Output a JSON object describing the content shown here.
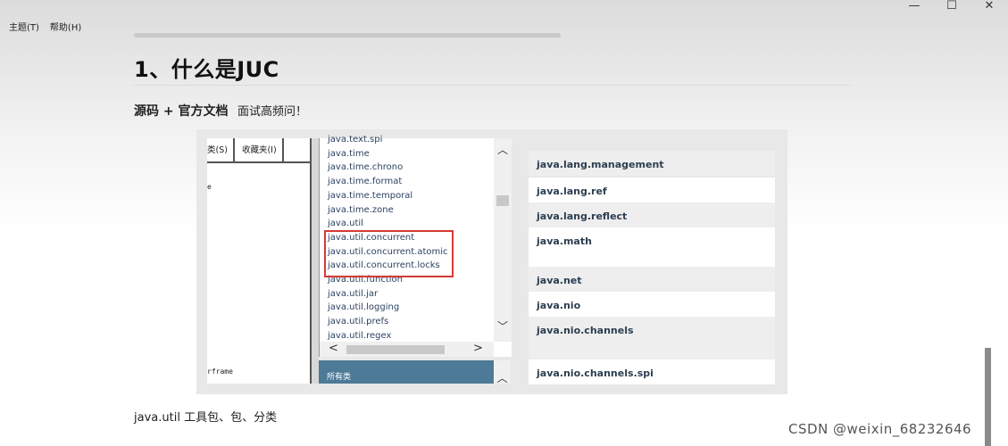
{
  "window": {
    "minimize": "—",
    "maximize": "☐",
    "close": "✕"
  },
  "menu": [
    "主题(T)",
    "帮助(H)"
  ],
  "article": {
    "heading": "1、什么是JUC",
    "subline_bold": "源码 + 官方文档",
    "subline_normal": "面试高频问！",
    "bottom_text": "java.util 工具包、包、分类"
  },
  "screenshot": {
    "tabs": [
      "类(S)",
      "收藏夹(I)"
    ],
    "left_fragment_top": "e",
    "left_fragment_bottom": "rframe",
    "packages": [
      "java.text.spi",
      "java.time",
      "java.time.chrono",
      "java.time.format",
      "java.time.temporal",
      "java.time.zone",
      "java.util",
      "java.util.concurrent",
      "java.util.concurrent.atomic",
      "java.util.concurrent.locks",
      "java.util.function",
      "java.util.jar",
      "java.util.logging",
      "java.util.prefs",
      "java.util.regex"
    ],
    "highlighted_packages": [
      "java.util.concurrent",
      "java.util.concurrent.atomic",
      "java.util.concurrent.locks"
    ],
    "all_classes": "所有类",
    "right_packages": [
      "java.lang.management",
      "java.lang.ref",
      "java.lang.reflect",
      "java.math",
      "java.net",
      "java.nio",
      "java.nio.channels",
      "java.nio.channels.spi"
    ],
    "highlight_color": "#d43b34",
    "header_color": "#4d7a97"
  },
  "watermark": "CSDN @weixin_68232646"
}
